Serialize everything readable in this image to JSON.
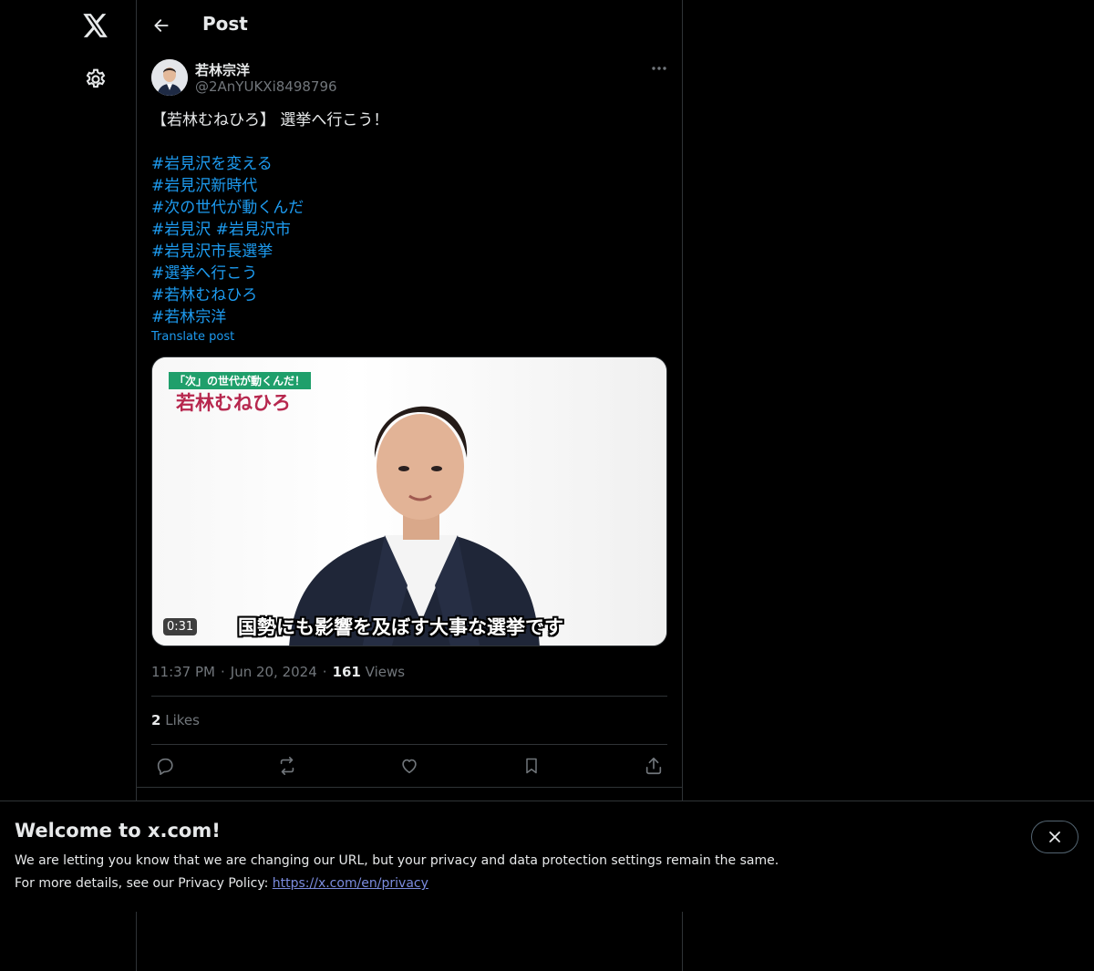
{
  "nav": {
    "logo_icon": "x-logo-icon",
    "settings_icon": "gear-icon"
  },
  "header": {
    "title": "Post",
    "back_icon": "arrow-left-icon"
  },
  "post": {
    "author_name": "若林宗洋",
    "author_handle": "@2AnYUKXi8498796",
    "text": "【若林むねひろ】 選挙へ行こう！",
    "hashtag_lines": [
      "#岩見沢を変える",
      "#岩見沢新時代",
      "#次の世代が動くんだ",
      "#岩見沢 #岩見沢市",
      "#岩見沢市長選挙",
      "#選挙へ行こう",
      "#若林むねひろ",
      "#若林宗洋"
    ],
    "translate_label": "Translate post",
    "media": {
      "tag_text": "「次」の世代が動くんだ！",
      "name_text": "若林むねひろ",
      "duration": "0:31",
      "subtitle": "国勢にも影響を及ぼす大事な選挙です"
    },
    "time": "11:37 PM",
    "date": "Jun 20, 2024",
    "views_count": "161",
    "views_label": "Views",
    "likes_count": "2",
    "likes_label": "Likes",
    "actions": [
      "reply-icon",
      "repost-icon",
      "like-icon",
      "bookmark-icon",
      "share-icon"
    ]
  },
  "banner": {
    "title": "Welcome to x.com!",
    "line1": "We are letting you know that we are changing our URL, but your privacy and data protection settings remain the same.",
    "line2_prefix": "For more details, see our Privacy Policy: ",
    "link_text": "https://x.com/en/privacy",
    "close_icon": "close-icon"
  },
  "colors": {
    "background": "#000000",
    "text": "#e7e9ea",
    "muted": "#71767b",
    "link": "#1d9bf0",
    "border": "#2f3336"
  }
}
